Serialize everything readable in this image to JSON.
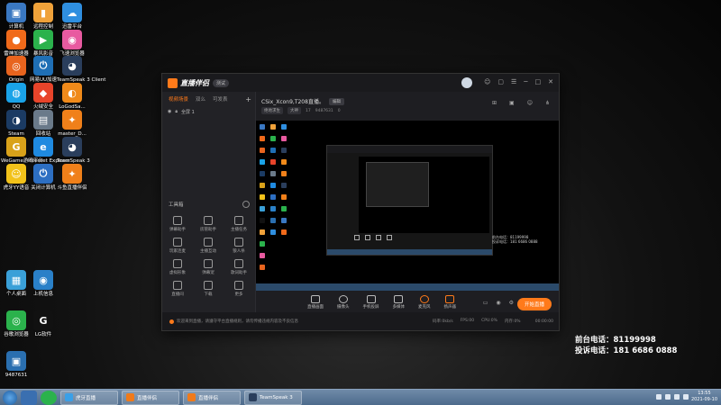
{
  "desktop": {
    "icons": [
      {
        "label": "计算机",
        "glyph": "▣",
        "color": "#3a78c2"
      },
      {
        "label": "远程控制",
        "glyph": "▮",
        "color": "#f0a23a"
      },
      {
        "label": "迅雷平台",
        "glyph": "☁",
        "color": "#2f8fe0"
      },
      {
        "label": "雷神加速器",
        "glyph": "●",
        "color": "#f06a1a"
      },
      {
        "label": "暴风影音",
        "glyph": "▶",
        "color": "#2bb24c"
      },
      {
        "label": "飞速浏览器",
        "glyph": "◉",
        "color": "#e85aa0"
      },
      {
        "label": "Origin",
        "glyph": "◎",
        "color": "#e8641e"
      },
      {
        "label": "网易UU加速",
        "glyph": "⏻",
        "color": "#1f6fb5"
      },
      {
        "label": "TeamSpeak 3 Client",
        "glyph": "◕",
        "color": "#2a3e5c"
      },
      {
        "label": "QQ",
        "glyph": "◍",
        "color": "#1aa3e8"
      },
      {
        "label": "火绒安全",
        "glyph": "◆",
        "color": "#e8442a"
      },
      {
        "label": "LoGodSa...",
        "glyph": "◐",
        "color": "#f08a1a"
      },
      {
        "label": "Steam",
        "glyph": "◑",
        "color": "#1b3b63"
      },
      {
        "label": "回收站",
        "glyph": "▤",
        "color": "#6a7a8a"
      },
      {
        "label": "master_D...",
        "glyph": "✦",
        "color": "#f0801a"
      },
      {
        "label": "WeGame游戏平台",
        "glyph": "G",
        "color": "#d9a21a"
      },
      {
        "label": "Internet Explorer",
        "glyph": "e",
        "color": "#1f8ae0"
      },
      {
        "label": "TeamSpeak 3",
        "glyph": "◕",
        "color": "#2a3e5c"
      },
      {
        "label": "虎牙YY语音",
        "glyph": "☺",
        "color": "#f2c21a"
      },
      {
        "label": "关闭计算机",
        "glyph": "⏻",
        "color": "#2d6fc2"
      },
      {
        "label": "斗鱼直播伴侣",
        "glyph": "✦",
        "color": "#f0801a"
      },
      {
        "label": "个人桌面",
        "glyph": "▦",
        "color": "#3aa0d8"
      },
      {
        "label": "上机信息",
        "glyph": "◉",
        "color": "#2a80c8"
      },
      {
        "label": "谷歌浏览器",
        "glyph": "◎",
        "color": "#2bb24c"
      },
      {
        "label": "LG软件",
        "glyph": "G",
        "color": "#111111"
      },
      {
        "label": "9487631",
        "glyph": "▣",
        "color": "#2a6fb0"
      }
    ],
    "contact": {
      "front_desk": "前台电话：81199998",
      "investment": "投诉电话：181 6686 0888"
    }
  },
  "app": {
    "name": "直播伴侣",
    "beta_label": "测试",
    "window_controls": [
      "☺",
      "▢",
      "☰",
      "─",
      "□",
      "✕"
    ],
    "left_tabs": [
      "视频场景",
      "双么",
      "可发表"
    ],
    "add_tab": "+",
    "scene_item": "全屏 1",
    "tools_label": "工具箱",
    "tools": [
      {
        "label": "弹幕助手"
      },
      {
        "label": "房管助手"
      },
      {
        "label": "主播任务"
      },
      {
        "label": "玩家连麦"
      },
      {
        "label": "主播互动"
      },
      {
        "label": "狼人杀"
      },
      {
        "label": "虚拟形象"
      },
      {
        "label": "弹幕宠"
      },
      {
        "label": "歌词助手"
      },
      {
        "label": "直播间"
      },
      {
        "label": "下载"
      },
      {
        "label": "更多"
      }
    ],
    "stream": {
      "title": "CSix_Xcon9,T208直播。",
      "edit_label": "编辑",
      "chip1": "绝地求生",
      "chip2": "大神",
      "viewers": "17",
      "room_id": "9487631",
      "hot": "0"
    },
    "controls": [
      {
        "label": "直播画面"
      },
      {
        "label": "摄像头"
      },
      {
        "label": "手机投屏"
      },
      {
        "label": "多媒体"
      },
      {
        "label": "麦克风"
      },
      {
        "label": "扬声器"
      }
    ],
    "go_live": "开始直播",
    "status": {
      "message": "欢迎来到直播，请遵守平台直播规则，请勿传播违规内容及不良信息",
      "bitrate": "码率:0kb/s",
      "fps": "FPS:00",
      "cpu": "CPU:0%",
      "mem": "内存:0%",
      "timer": "00:00:00"
    }
  },
  "taskbar": {
    "items": [
      {
        "label": "虎牙直播",
        "color": "#3aa0e8"
      },
      {
        "label": "直播伴侣",
        "color": "#f07a1a"
      },
      {
        "label": "直播伴侣",
        "color": "#f07a1a"
      },
      {
        "label": "TeamSpeak 3",
        "color": "#2a3e5c"
      }
    ],
    "time": "13:55",
    "date": "2021-09-10"
  }
}
